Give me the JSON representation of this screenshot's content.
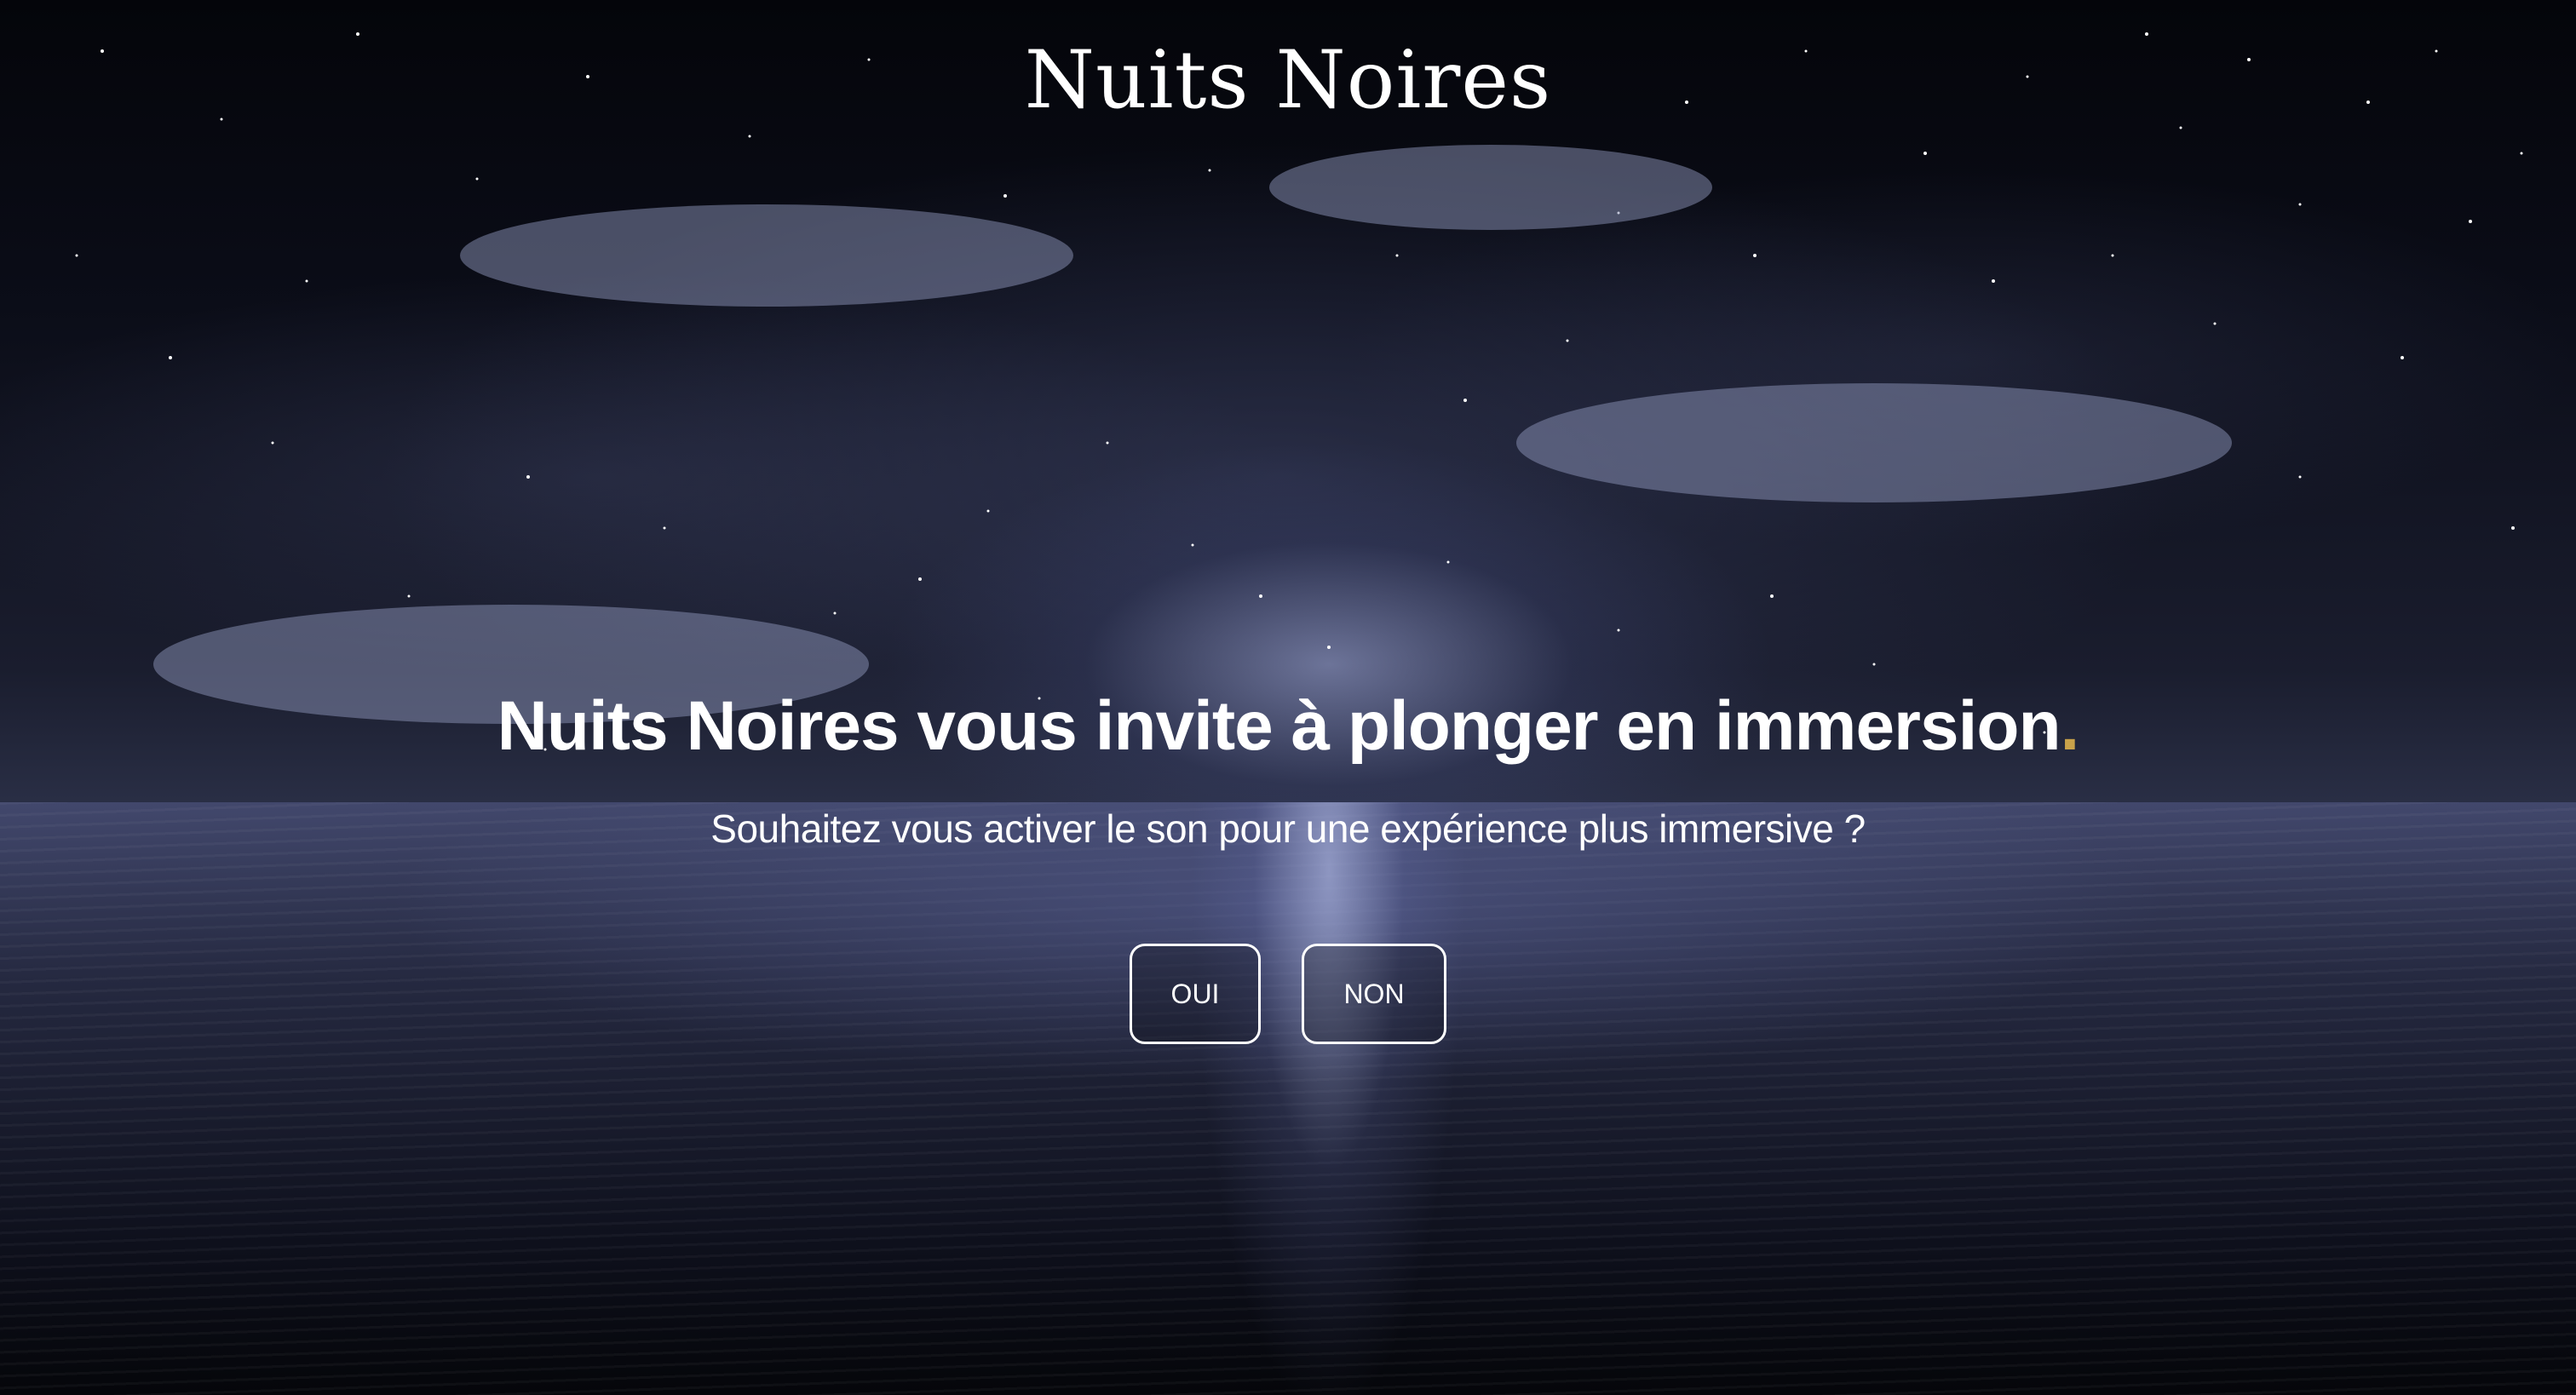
{
  "brand": {
    "logo_text": "Nuits Noires"
  },
  "intro": {
    "headline": "Nuits Noires vous invite à plonger en immersion",
    "headline_dot": ".",
    "question": "Souhaitez vous activer le son pour une expérience plus immersive ?"
  },
  "actions": {
    "yes_label": "OUI",
    "no_label": "NON"
  },
  "colors": {
    "accent_dot": "#c9a24a",
    "text": "#ffffff",
    "background": "#0b0d18"
  }
}
